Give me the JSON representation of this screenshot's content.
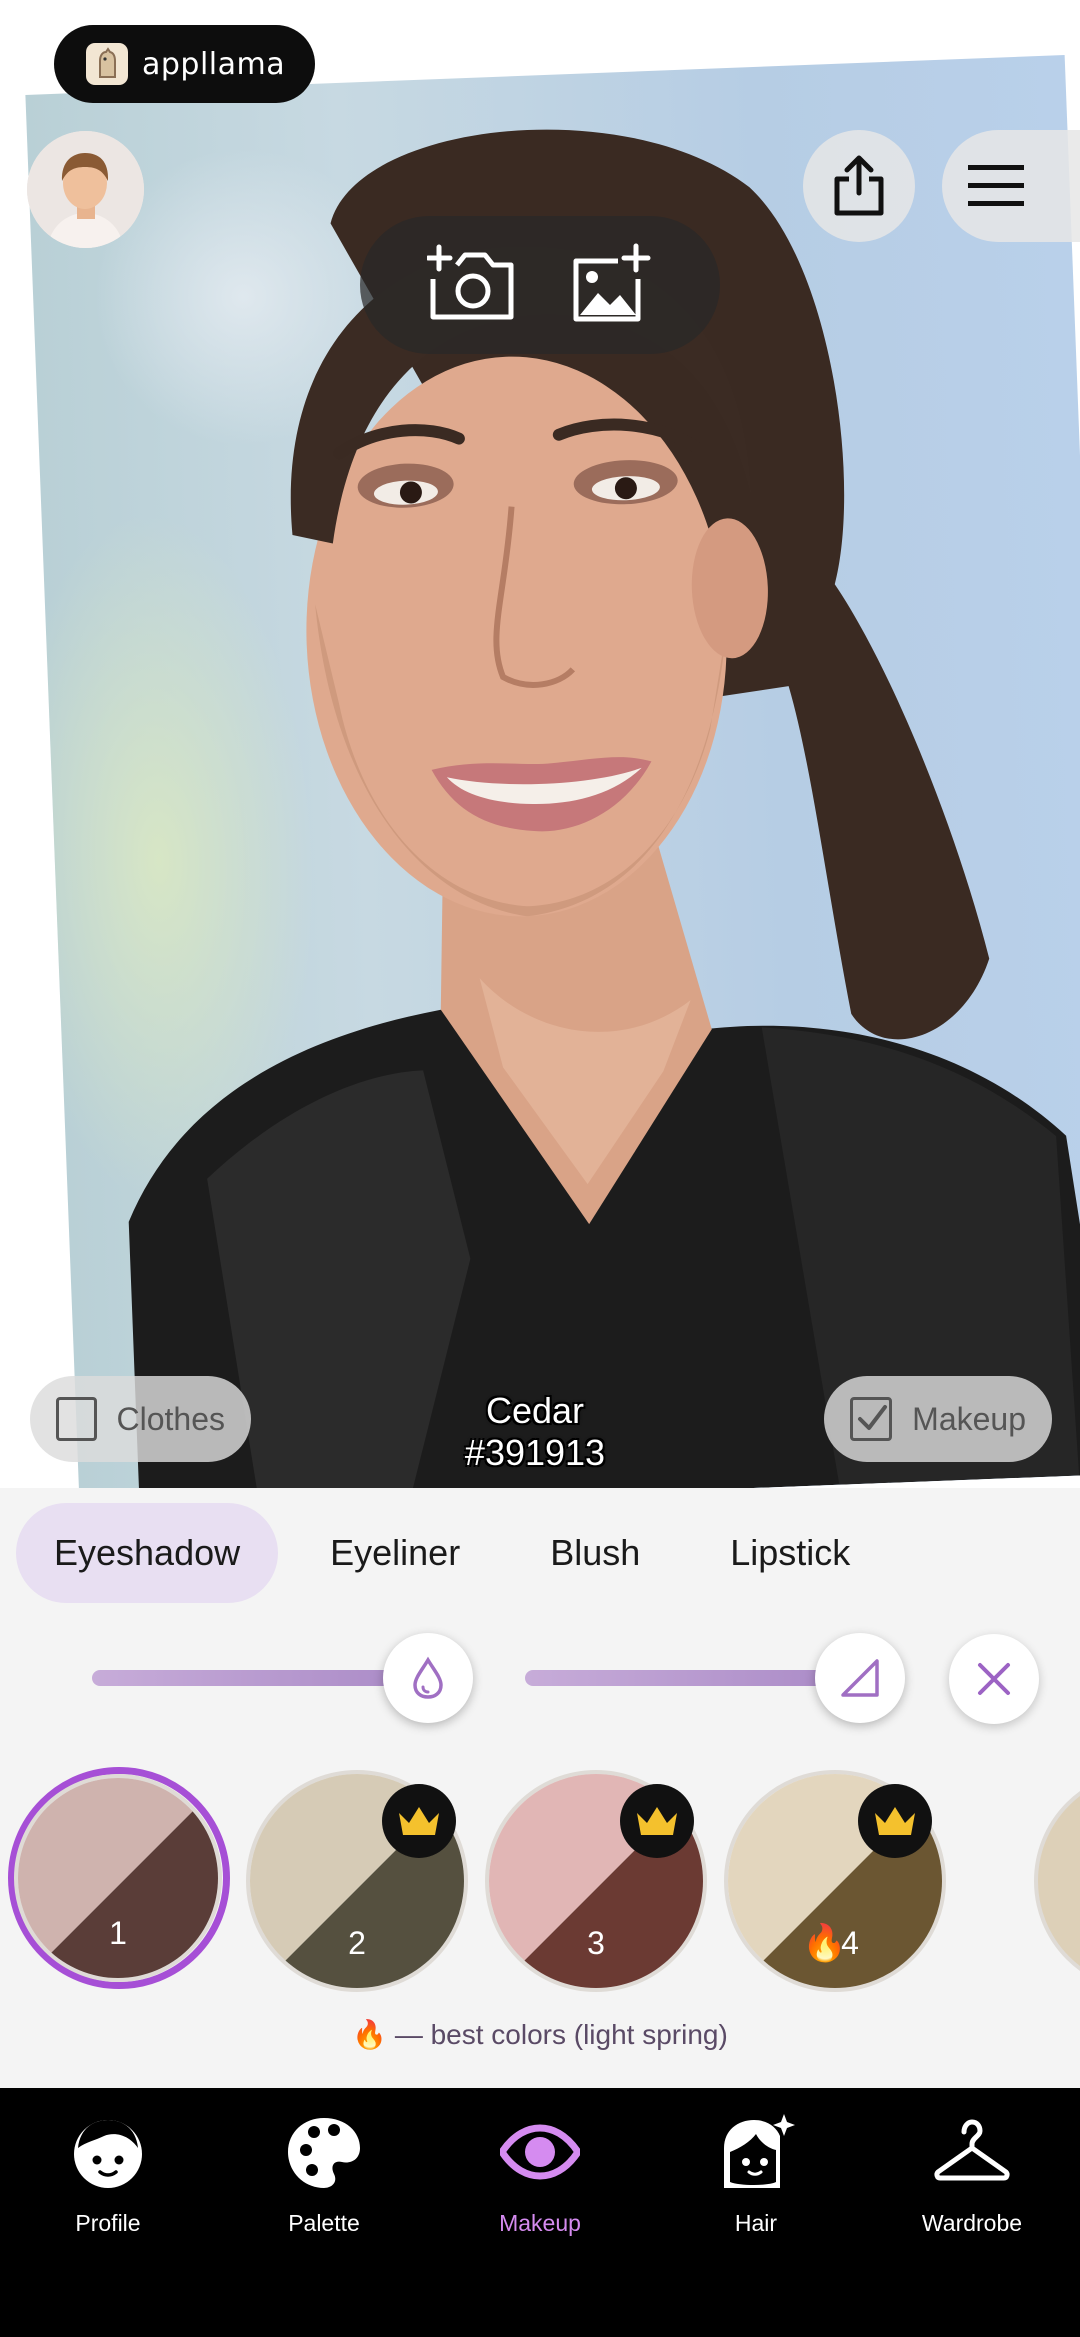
{
  "brand": {
    "name": "appllama"
  },
  "photo": {
    "color_name": "Cedar",
    "color_hex": "#391913",
    "clothes_label": "Clothes",
    "clothes_checked": false,
    "makeup_label": "Makeup",
    "makeup_checked": true
  },
  "tabs": [
    {
      "label": "Eyeshadow",
      "active": true
    },
    {
      "label": "Eyeliner",
      "active": false
    },
    {
      "label": "Blush",
      "active": false
    },
    {
      "label": "Lipstick",
      "active": false
    }
  ],
  "sliders": {
    "intensity": {
      "icon": "drop-icon",
      "value": 0.92
    },
    "shape": {
      "icon": "triangle-icon",
      "value": 0.92
    }
  },
  "swatches": [
    {
      "label": "1",
      "top": "#cfb3ae",
      "bottom": "#5a3d38",
      "premium": false,
      "best": false,
      "selected": true
    },
    {
      "label": "2",
      "top": "#d6cbb6",
      "bottom": "#55503f",
      "premium": true,
      "best": false,
      "selected": false
    },
    {
      "label": "3",
      "top": "#e1b6b5",
      "bottom": "#6b3a33",
      "premium": true,
      "best": false,
      "selected": false
    },
    {
      "label": "4",
      "top": "#e3d6be",
      "bottom": "#6b5632",
      "premium": true,
      "best": true,
      "selected": false
    }
  ],
  "best_note": "🔥 — best colors (light spring)",
  "nav": [
    {
      "label": "Profile",
      "icon": "face-icon",
      "active": false
    },
    {
      "label": "Palette",
      "icon": "palette-icon",
      "active": false
    },
    {
      "label": "Makeup",
      "icon": "eye-icon",
      "active": true
    },
    {
      "label": "Hair",
      "icon": "hair-icon",
      "active": false
    },
    {
      "label": "Wardrobe",
      "icon": "hanger-icon",
      "active": false
    }
  ],
  "colors": {
    "accent": "#a64fd6",
    "nav_active": "#d58bf0",
    "tab_active_bg": "#e8dff2"
  }
}
